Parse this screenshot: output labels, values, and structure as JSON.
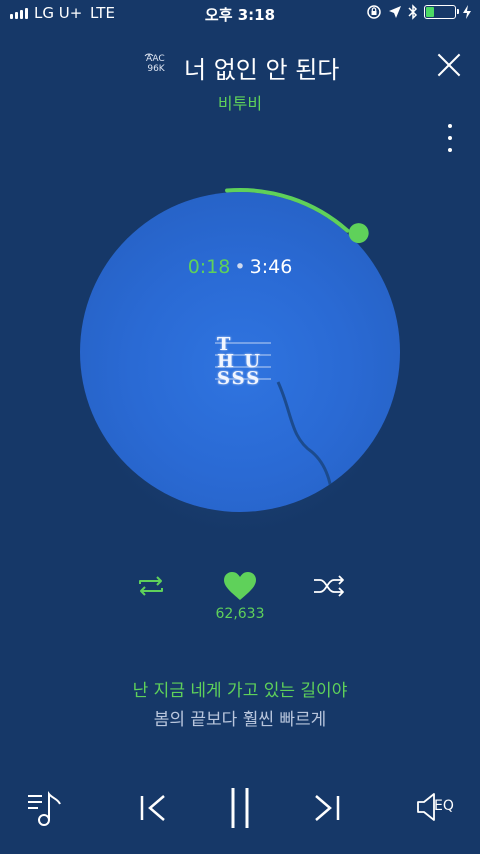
{
  "status_bar": {
    "carrier": "LG U+",
    "network": "LTE",
    "time": "오후 3:18",
    "battery_level": 0.3
  },
  "header": {
    "codec_line1": "AAC",
    "codec_line2": "96K",
    "song_title": "너 없인 안 된다",
    "artist": "비투비"
  },
  "player": {
    "elapsed": "0:18",
    "separator": "•",
    "total": "3:46",
    "progress": 0.08,
    "album_text_line1": "T",
    "album_text_line2": "H  U",
    "album_text_line3": "SSS",
    "like_count": "62,633"
  },
  "lyrics": {
    "current": "난 지금 네게 가고 있는 길이야",
    "next": "봄의 끝보다 훨씬 빠르게"
  },
  "bottom_bar": {
    "eq_label": "EQ"
  },
  "colors": {
    "background": "#163868",
    "accent": "#5fd15a",
    "disc": "#2a6ad4"
  }
}
